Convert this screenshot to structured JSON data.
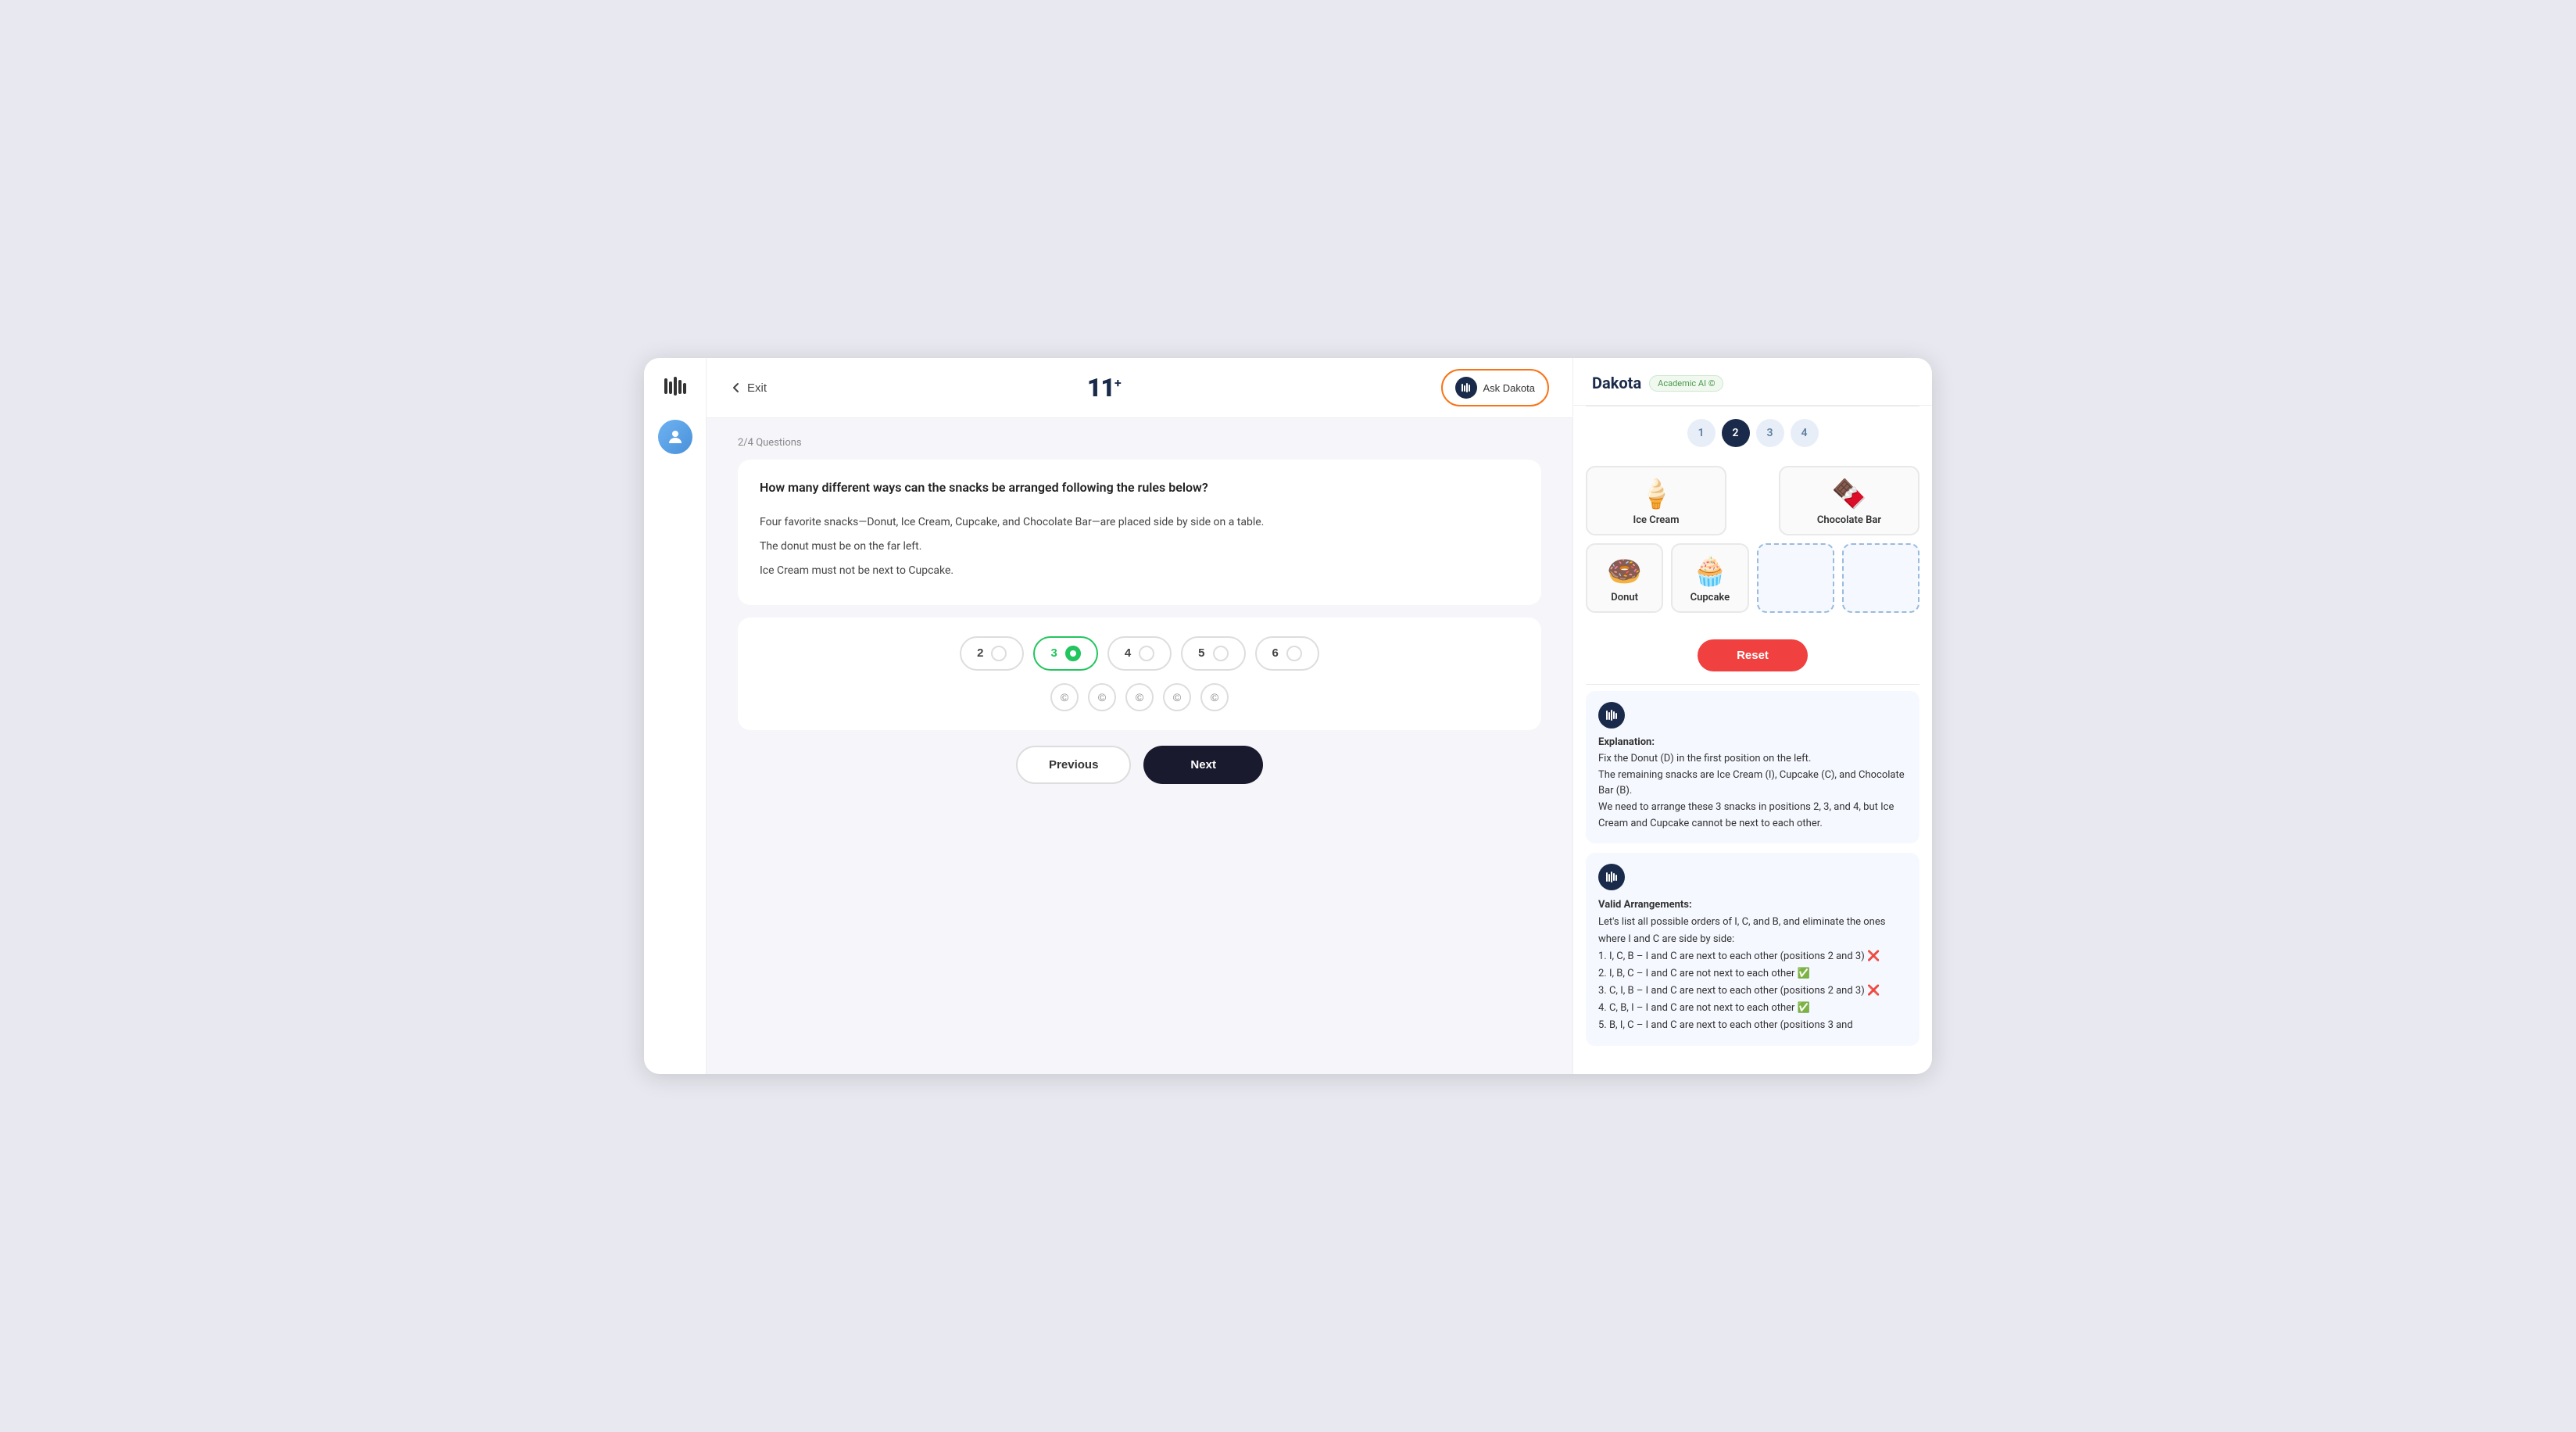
{
  "app": {
    "logo": "11",
    "logo_sup": "+",
    "exit_label": "Exit",
    "ask_dakota_label": "Ask Dakota"
  },
  "question": {
    "progress": "2/4 Questions",
    "title": "How many different ways can the snacks be arranged following the rules below?",
    "body_lines": [
      "Four favorite snacks—Donut, Ice Cream, Cupcake, and Chocolate Bar—are placed side by side on a table.",
      "The donut must be on the far left.",
      "Ice Cream must not be next to Cupcake."
    ]
  },
  "answers": {
    "options": [
      {
        "value": "2",
        "selected": false
      },
      {
        "value": "3",
        "selected": true
      },
      {
        "value": "4",
        "selected": false
      },
      {
        "value": "5",
        "selected": false
      },
      {
        "value": "6",
        "selected": false
      }
    ]
  },
  "navigation": {
    "previous_label": "Previous",
    "next_label": "Next"
  },
  "dakota": {
    "name": "Dakota",
    "badge": "Academic AI ©",
    "steps": [
      {
        "num": "1",
        "active": false
      },
      {
        "num": "2",
        "active": true
      },
      {
        "num": "3",
        "active": false
      },
      {
        "num": "4",
        "active": false
      }
    ]
  },
  "snacks": {
    "top_row": [
      {
        "name": "Ice Cream",
        "emoji": "🍦",
        "empty": false
      },
      {
        "name": "",
        "emoji": "",
        "empty": true
      },
      {
        "name": "Chocolate Bar",
        "emoji": "🍫",
        "empty": false
      }
    ],
    "bottom_row": [
      {
        "name": "Donut",
        "emoji": "🍩",
        "empty": false
      },
      {
        "name": "Cupcake",
        "emoji": "🧁",
        "empty": false
      },
      {
        "name": "",
        "emoji": "",
        "empty": true
      },
      {
        "name": "",
        "emoji": "",
        "empty": true
      }
    ],
    "reset_label": "Reset"
  },
  "explanation": {
    "title": "Explanation:",
    "text": "Fix the Donut (D) in the first position on the left.\nThe remaining snacks are Ice Cream (I), Cupcake (C), and Chocolate Bar (B).\nWe need to arrange these 3 snacks in positions 2, 3, and 4, but Ice Cream and Cupcake cannot be next to each other."
  },
  "valid_arrangements": {
    "title": "Valid Arrangements:",
    "intro": "Let's list all possible orders of I, C, and B, and eliminate the ones where I and C are side by side:",
    "items": [
      "1. I, C, B – I and C are next to each other (positions 2 and 3) ❌",
      "2. I, B, C – I and C are not next to each other ✅",
      "3. C, I, B – I and C are next to each other (positions 2 and 3) ❌",
      "4. C, B, I – I and C are not next to each other ✅",
      "5. B, I, C – I and C are next to each other (positions 3 and"
    ]
  }
}
